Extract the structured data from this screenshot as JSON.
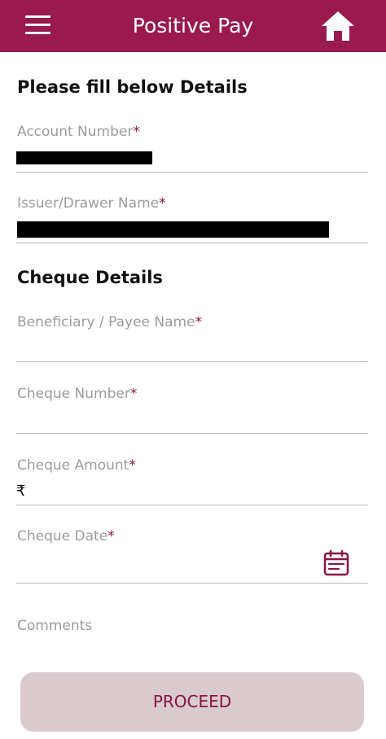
{
  "header": {
    "title": "Positive Pay",
    "accent_color": "#9a1a4d",
    "menu_icon": "hamburger-icon",
    "home_icon": "home-icon"
  },
  "account_section": {
    "title": "Please fill below Details",
    "account_number": {
      "label": "Account Number",
      "required_mark": "*"
    },
    "issuer_name": {
      "label": "Issuer/Drawer Name",
      "required_mark": "*"
    }
  },
  "cheque_section": {
    "title": "Cheque Details",
    "beneficiary": {
      "label": "Beneficiary / Payee Name",
      "required_mark": "*"
    },
    "cheque_number": {
      "label": "Cheque Number",
      "required_mark": "*"
    },
    "cheque_amount": {
      "label": "Cheque Amount",
      "required_mark": "*",
      "currency_symbol": "₹"
    },
    "cheque_date": {
      "label": "Cheque Date",
      "required_mark": "*",
      "icon": "calendar-icon"
    },
    "comments": {
      "label": "Comments"
    }
  },
  "actions": {
    "proceed_label": "PROCEED",
    "button_bg": "#d9cace",
    "button_text_color": "#8a1444"
  }
}
